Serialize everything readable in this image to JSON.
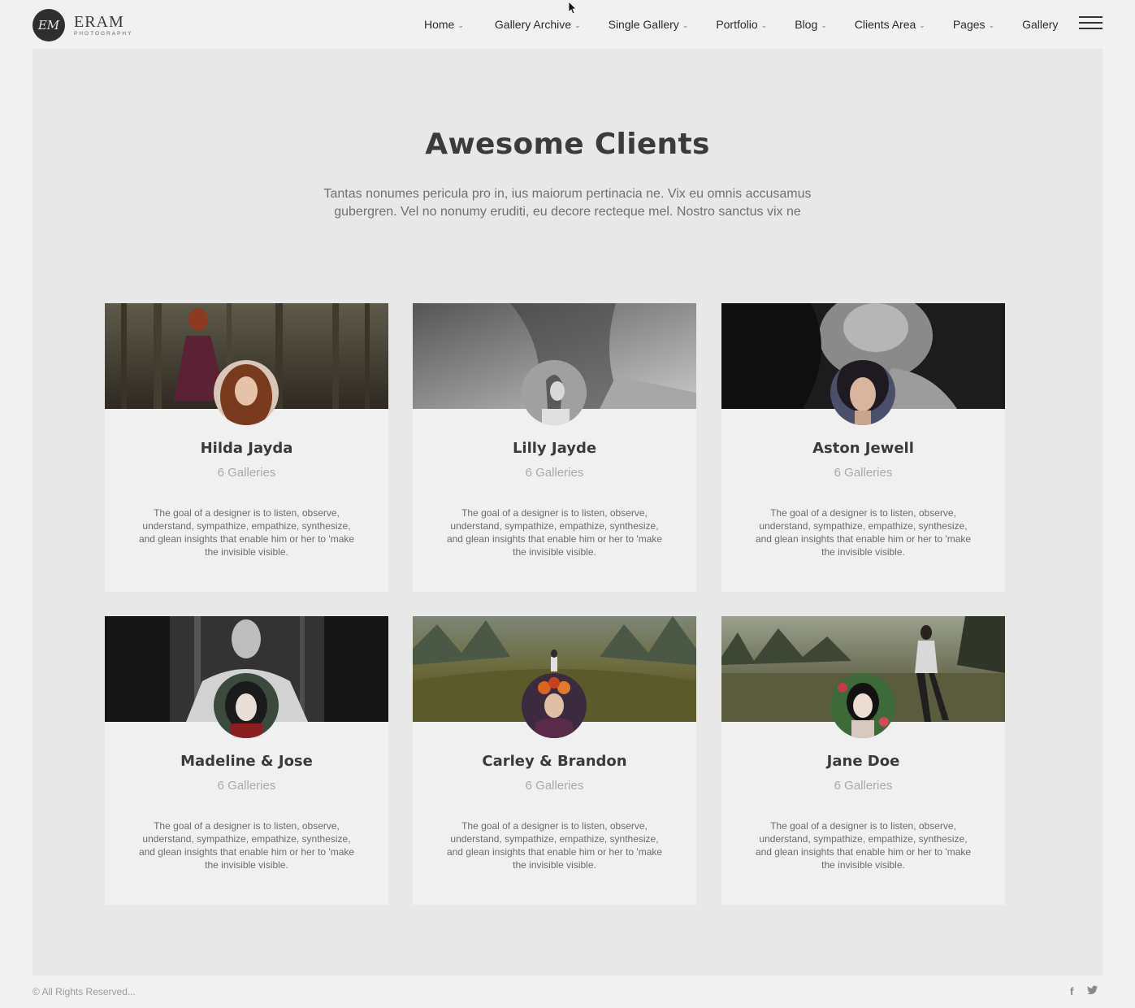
{
  "brand": {
    "monogram": "EM",
    "name": "ERAM",
    "tagline": "PHOTOGRAPHY"
  },
  "nav": {
    "items": [
      {
        "label": "Home",
        "dropdown": true
      },
      {
        "label": "Gallery Archive",
        "dropdown": true
      },
      {
        "label": "Single Gallery",
        "dropdown": true
      },
      {
        "label": "Portfolio",
        "dropdown": true
      },
      {
        "label": "Blog",
        "dropdown": true
      },
      {
        "label": "Clients Area",
        "dropdown": true
      },
      {
        "label": "Pages",
        "dropdown": true
      },
      {
        "label": "Gallery",
        "dropdown": false
      }
    ],
    "menu_icon": "hamburger-icon"
  },
  "main": {
    "title": "Awesome Clients",
    "intro": "Tantas nonumes pericula pro in, ius maiorum pertinacia ne. Vix eu omnis accusamus gubergren. Vel no nonumy eruditi, eu decore recteque mel. Nostro sanctus vix ne"
  },
  "clients": [
    {
      "name": "Hilda Jayda",
      "galleries": "6 Galleries",
      "description": "The goal of a designer is to listen, observe, understand, sympathize, empathize, synthesize, and glean insights that enable him or her to 'make the invisible visible."
    },
    {
      "name": "Lilly Jayde",
      "galleries": "6 Galleries",
      "description": "The goal of a designer is to listen, observe, understand, sympathize, empathize, synthesize, and glean insights that enable him or her to 'make the invisible visible."
    },
    {
      "name": "Aston Jewell",
      "galleries": "6 Galleries",
      "description": "The goal of a designer is to listen, observe, understand, sympathize, empathize, synthesize, and glean insights that enable him or her to 'make the invisible visible."
    },
    {
      "name": "Madeline & Jose",
      "galleries": "6 Galleries",
      "description": "The goal of a designer is to listen, observe, understand, sympathize, empathize, synthesize, and glean insights that enable him or her to 'make the invisible visible."
    },
    {
      "name": "Carley & Brandon",
      "galleries": "6 Galleries",
      "description": "The goal of a designer is to listen, observe, understand, sympathize, empathize, synthesize, and glean insights that enable him or her to 'make the invisible visible."
    },
    {
      "name": "Jane Doe",
      "galleries": "6 Galleries",
      "description": "The goal of a designer is to listen, observe, understand, sympathize, empathize, synthesize, and glean insights that enable him or her to 'make the invisible visible."
    }
  ],
  "footer": {
    "copyright": "© All Rights Reserved...",
    "social": [
      {
        "icon": "facebook-icon",
        "glyph": "f"
      },
      {
        "icon": "twitter-icon",
        "glyph": "t"
      }
    ]
  },
  "colors": {
    "page_bg": "#f1f1f1",
    "panel_bg": "#e8e8e8",
    "card_bg": "#f0f0f0",
    "title": "#3b3b3b",
    "muted": "#a9a9a9"
  }
}
